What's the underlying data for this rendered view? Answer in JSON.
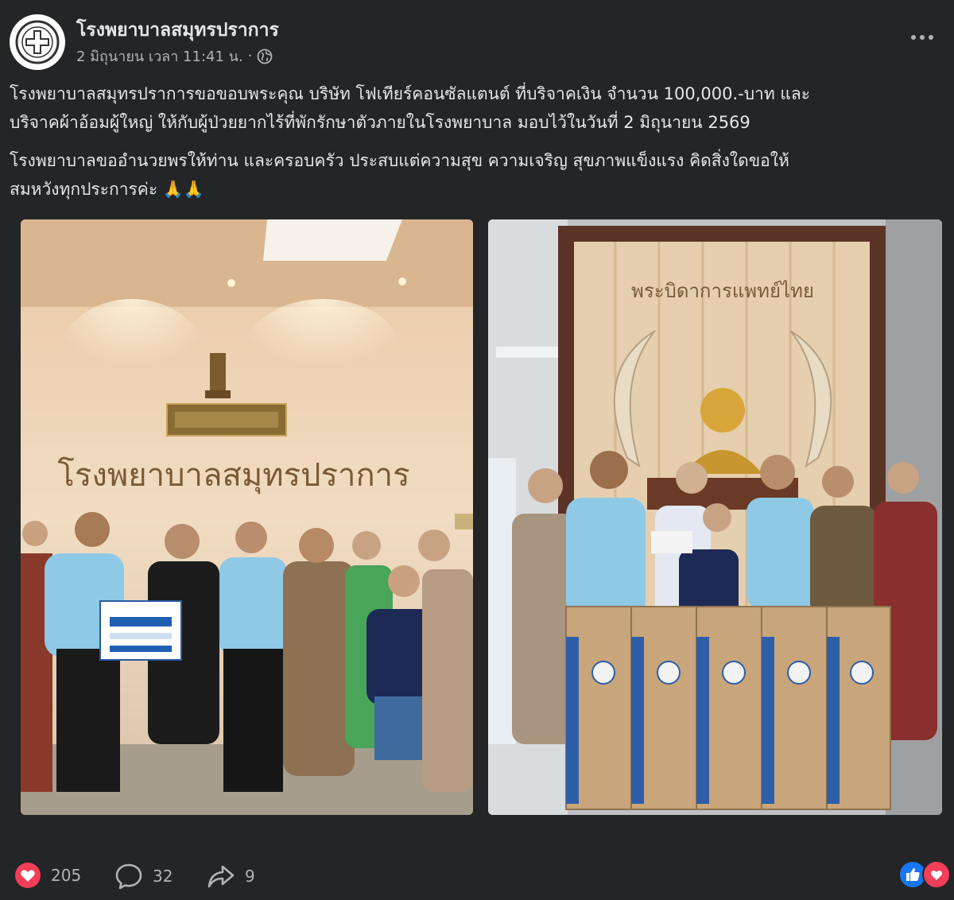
{
  "post": {
    "page_name": "โรงพยาบาลสมุทรปราการ",
    "date": "2 มิถุนายน เวลา 11:41 น.",
    "separator": "·",
    "paragraph1_line1": "โรงพยาบาลสมุทรปราการขอขอบพระคุณ บริษัท โฟเทียร์คอนซัลแตนต์ ที่บริจาคเงิน จำนวน 100,000.-บาท และ",
    "paragraph1_line2": "บริจาคผ้าอ้อมผู้ใหญ่ ให้กับผู้ป่วยยากไร้ที่พักรักษาตัวภายในโรงพยาบาล มอบไว้ในวันที่ 2 มิถุนายน 2569",
    "paragraph2_line1": "โรงพยาบาลขออำนวยพรให้ท่าน และครอบครัว ประสบแต่ความสุข ความเจริญ สุขภาพแข็งแรง คิดสิ่งใดขอให้",
    "paragraph2_line2": "สมหวังทุกประการค่ะ 🙏🙏"
  },
  "photos": {
    "left": {
      "wall_sign": "โรงพยาบาลสมุทรปราการ"
    },
    "right": {
      "wall_sign": "พระบิดาการแพทย์ไทย"
    }
  },
  "footer": {
    "reactions_count": "205",
    "comments_count": "32",
    "shares_count": "9"
  },
  "colors": {
    "background": "#242526",
    "text": "#e4e6eb",
    "secondary": "#b0b3b8",
    "love": "#f33e58",
    "like": "#1877f2"
  }
}
